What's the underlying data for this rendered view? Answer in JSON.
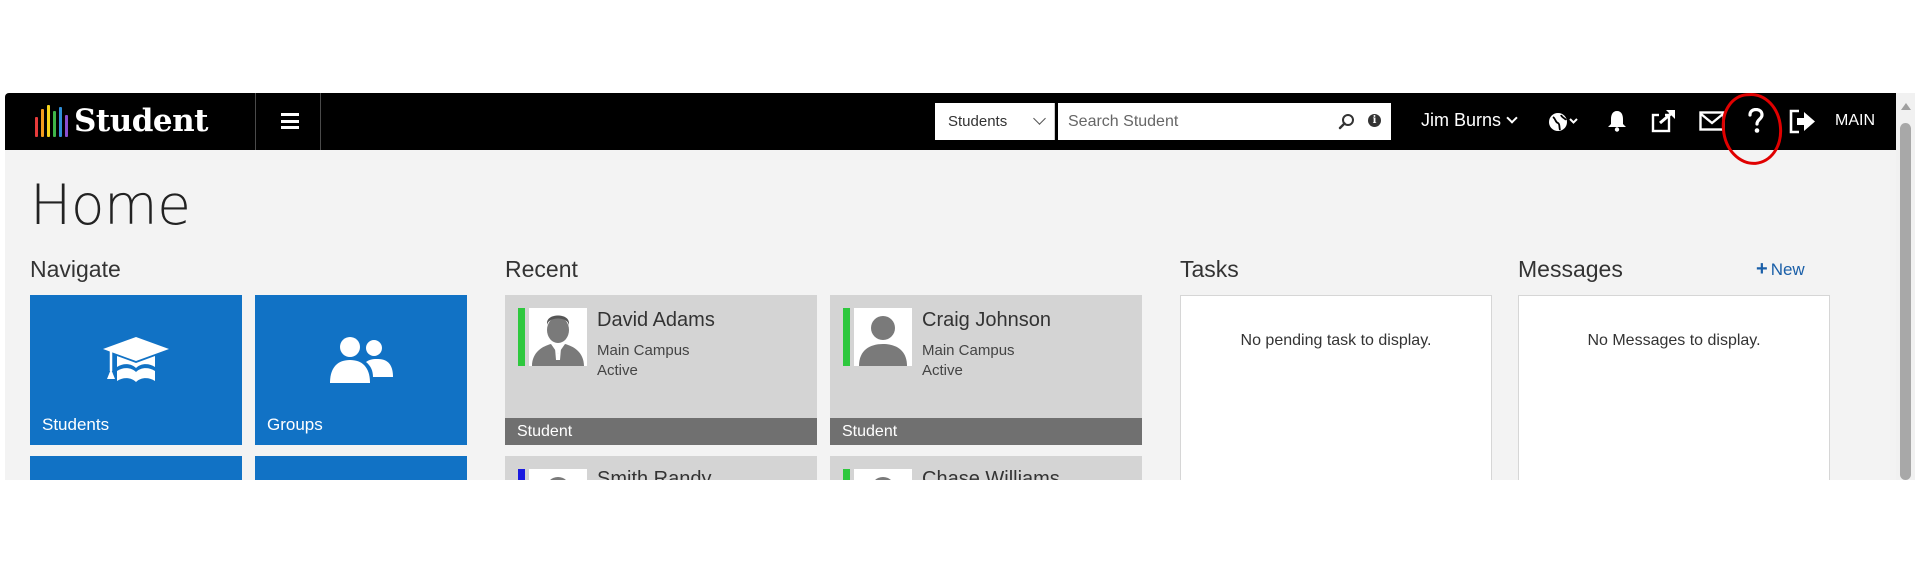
{
  "header": {
    "logo_text": "Student",
    "search": {
      "scope_value": "Students",
      "placeholder": "Search Student"
    },
    "user_name": "Jim Burns",
    "main_label": "MAIN"
  },
  "page": {
    "title": "Home"
  },
  "navigate": {
    "title": "Navigate",
    "tiles": [
      {
        "label": "Students",
        "icon": "graduation-cap-icon"
      },
      {
        "label": "Groups",
        "icon": "group-icon"
      }
    ]
  },
  "recent": {
    "title": "Recent",
    "cards": [
      {
        "name": "David Adams",
        "campus": "Main Campus",
        "status": "Active",
        "type": "Student",
        "bar_color": "#2ec83e"
      },
      {
        "name": "Craig Johnson",
        "campus": "Main Campus",
        "status": "Active",
        "type": "Student",
        "bar_color": "#2ec83e"
      },
      {
        "name": "Smith Randy",
        "bar_color": "#1a1ae0"
      },
      {
        "name": "Chase Williams",
        "bar_color": "#2ec83e"
      }
    ]
  },
  "tasks": {
    "title": "Tasks",
    "empty_text": "No pending task to display."
  },
  "messages": {
    "title": "Messages",
    "new_label": "New",
    "empty_text": "No Messages to display."
  },
  "colors": {
    "tile_blue": "#1172c5",
    "topbar": "#000000",
    "active_green": "#2ec83e",
    "annotation_red": "#e00000"
  }
}
